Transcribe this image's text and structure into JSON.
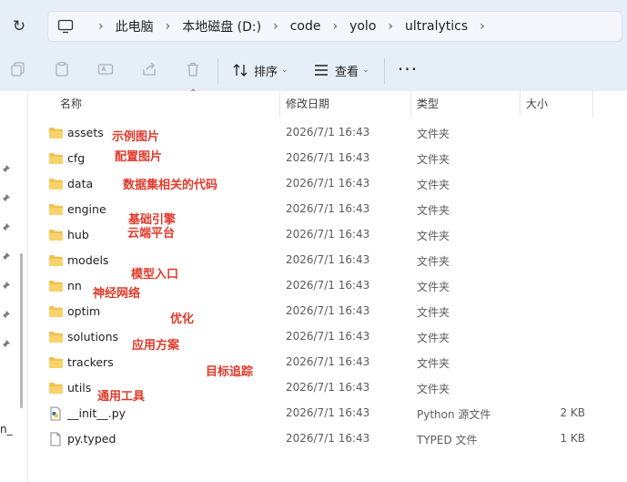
{
  "breadcrumb": {
    "items": [
      "此电脑",
      "本地磁盘 (D:)",
      "code",
      "yolo",
      "ultralytics"
    ]
  },
  "toolbar": {
    "sort_label": "排序",
    "view_label": "查看",
    "more_label": "···"
  },
  "left_pane": {
    "cut_text": "n_"
  },
  "columns": {
    "name": "名称",
    "date": "修改日期",
    "type": "类型",
    "size": "大小"
  },
  "files": [
    {
      "name": "assets",
      "date": "2026/7/1 16:43",
      "type": "文件夹",
      "size": "",
      "icon": "folder-icon"
    },
    {
      "name": "cfg",
      "date": "2026/7/1 16:43",
      "type": "文件夹",
      "size": "",
      "icon": "folder-icon"
    },
    {
      "name": "data",
      "date": "2026/7/1 16:43",
      "type": "文件夹",
      "size": "",
      "icon": "folder-icon"
    },
    {
      "name": "engine",
      "date": "2026/7/1 16:43",
      "type": "文件夹",
      "size": "",
      "icon": "folder-icon"
    },
    {
      "name": "hub",
      "date": "2026/7/1 16:43",
      "type": "文件夹",
      "size": "",
      "icon": "folder-icon"
    },
    {
      "name": "models",
      "date": "2026/7/1 16:43",
      "type": "文件夹",
      "size": "",
      "icon": "folder-icon"
    },
    {
      "name": "nn",
      "date": "2026/7/1 16:43",
      "type": "文件夹",
      "size": "",
      "icon": "folder-icon"
    },
    {
      "name": "optim",
      "date": "2026/7/1 16:43",
      "type": "文件夹",
      "size": "",
      "icon": "folder-icon"
    },
    {
      "name": "solutions",
      "date": "2026/7/1 16:43",
      "type": "文件夹",
      "size": "",
      "icon": "folder-icon"
    },
    {
      "name": "trackers",
      "date": "2026/7/1 16:43",
      "type": "文件夹",
      "size": "",
      "icon": "folder-icon"
    },
    {
      "name": "utils",
      "date": "2026/7/1 16:43",
      "type": "文件夹",
      "size": "",
      "icon": "folder-icon"
    },
    {
      "name": "__init__.py",
      "date": "2026/7/1 16:43",
      "type": "Python 源文件",
      "size": "2 KB",
      "icon": "python-file-icon"
    },
    {
      "name": "py.typed",
      "date": "2026/7/1 16:43",
      "type": "TYPED 文件",
      "size": "1 KB",
      "icon": "file-icon"
    }
  ],
  "annotations": [
    "示例图片",
    "配置图片",
    "数据集相关的代码",
    "基础引擎",
    "云端平台",
    "模型入口",
    "神经网络",
    "优化",
    "应用方案",
    "目标追踪",
    "通用工具"
  ],
  "colors": {
    "annotation": "#e03a2b",
    "folder": "#f2c14e",
    "topbar": "#e6eef8"
  }
}
